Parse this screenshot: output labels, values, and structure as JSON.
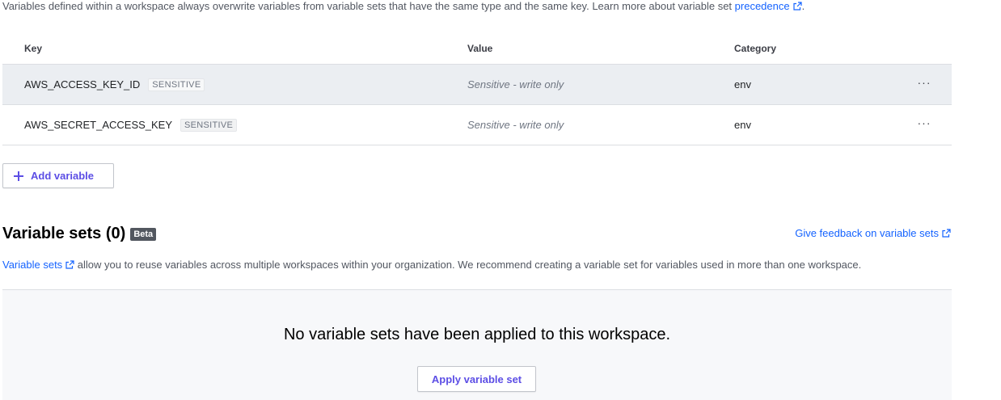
{
  "intro": {
    "text": "Variables defined within a workspace always overwrite variables from variable sets that have the same type and the same key. Learn more about variable set ",
    "link": "precedence",
    "suffix": "."
  },
  "table": {
    "headers": {
      "key": "Key",
      "value": "Value",
      "category": "Category"
    },
    "rows": [
      {
        "key": "AWS_ACCESS_KEY_ID",
        "badge": "SENSITIVE",
        "value": "Sensitive - write only",
        "category": "env",
        "menu": "···"
      },
      {
        "key": "AWS_SECRET_ACCESS_KEY",
        "badge": "SENSITIVE",
        "value": "Sensitive - write only",
        "category": "env",
        "menu": "···"
      }
    ]
  },
  "add_variable_label": "Add variable",
  "variable_sets": {
    "title": "Variable sets (0)",
    "badge": "Beta",
    "feedback_link": "Give feedback on variable sets",
    "desc_link": "Variable sets",
    "desc_text": " allow you to reuse variables across multiple workspaces within your organization. We recommend creating a variable set for variables used in more than one workspace.",
    "empty_message": "No variable sets have been applied to this workspace.",
    "apply_label": "Apply variable set"
  },
  "colors": {
    "link": "#1563ff",
    "button_text": "#5c4ee5",
    "row_hover": "#ebeef2"
  }
}
